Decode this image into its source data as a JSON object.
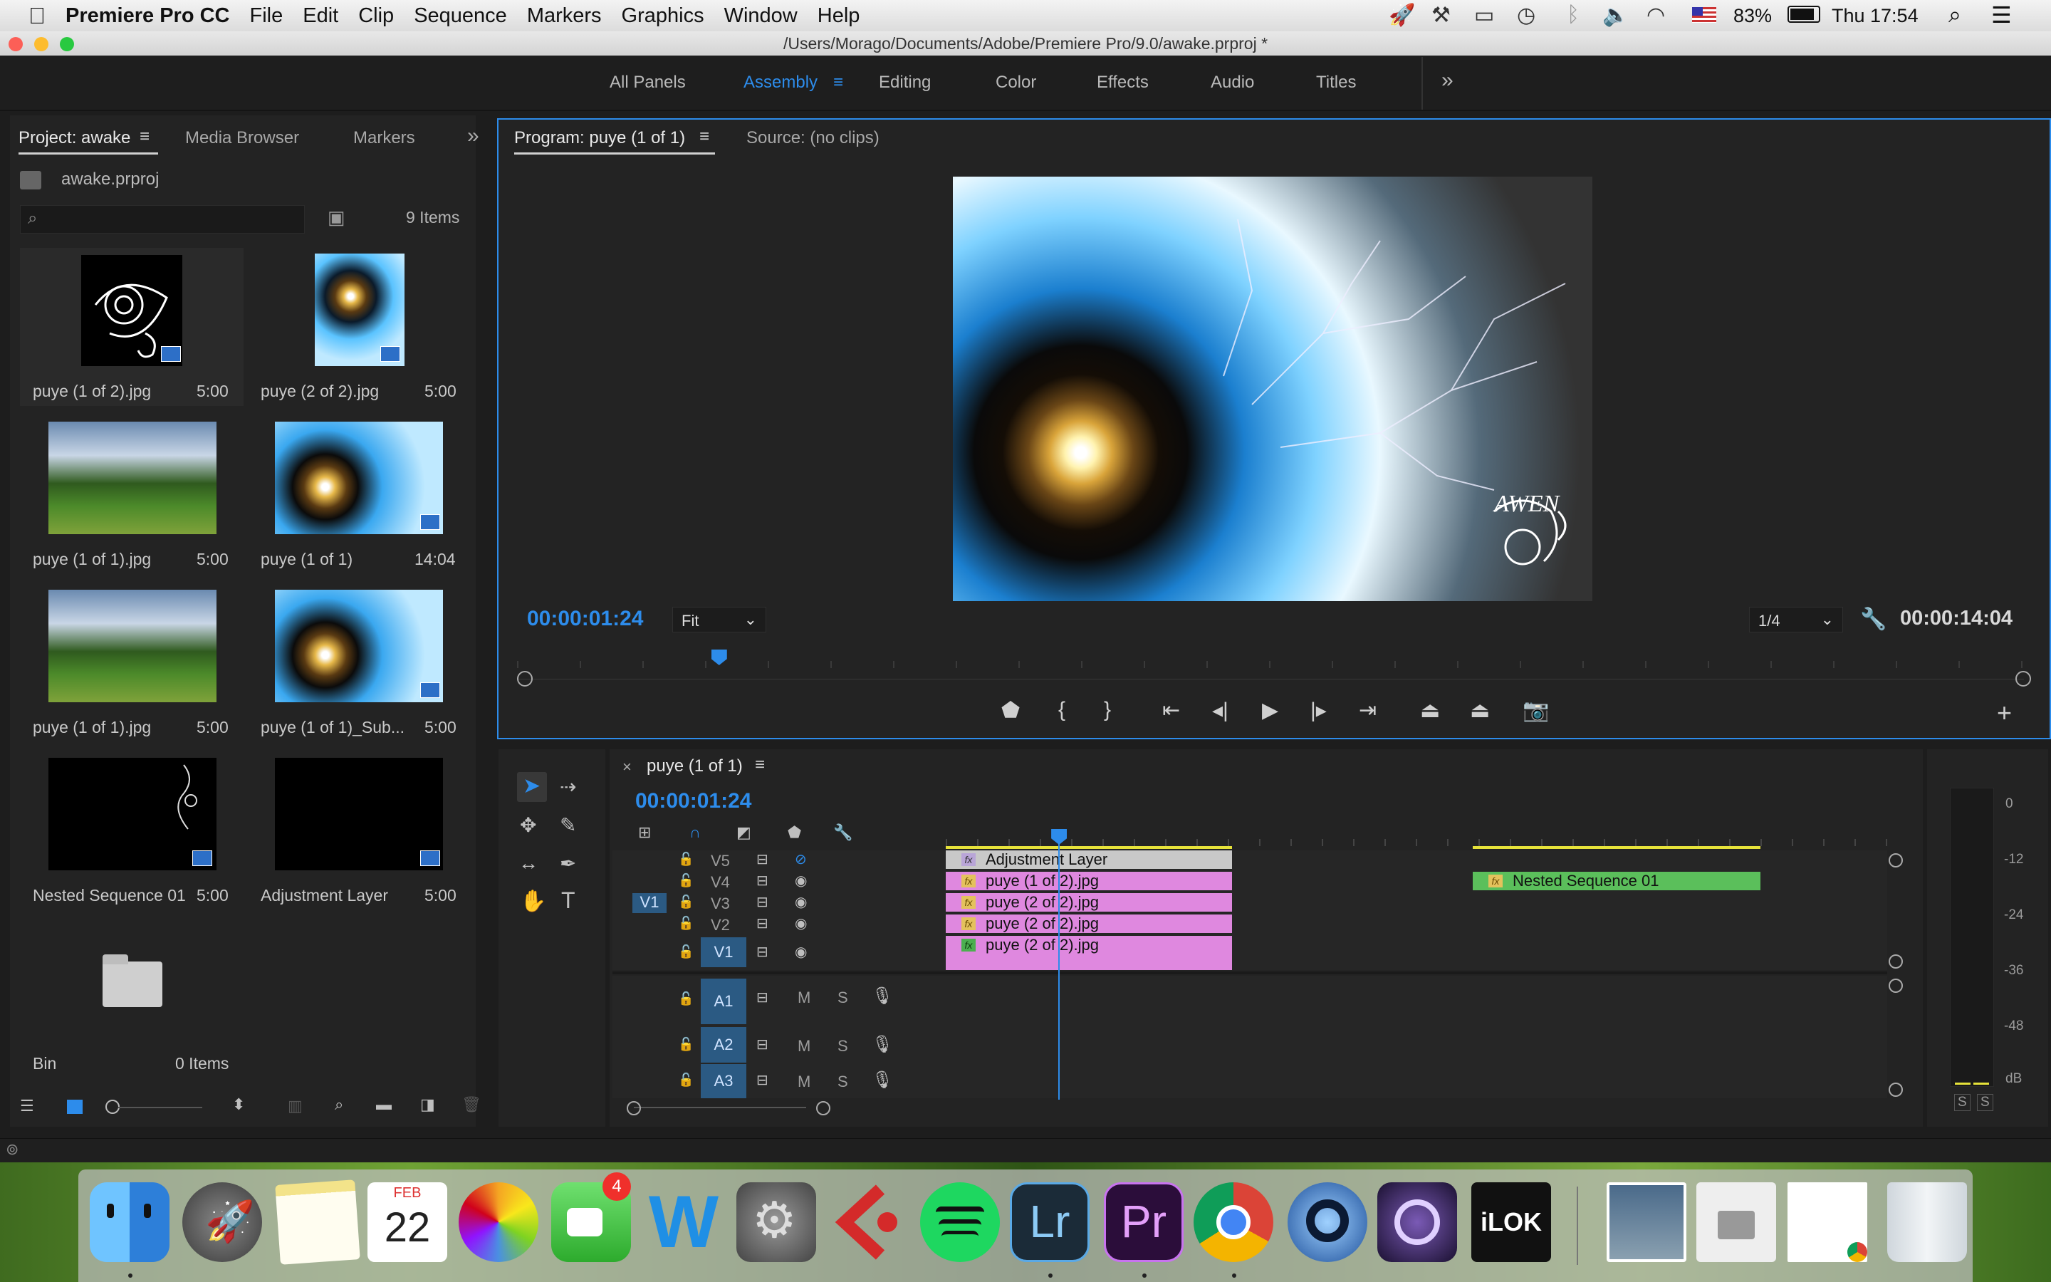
{
  "menubar": {
    "apple": "",
    "app_name": "Premiere Pro CC",
    "items": [
      "File",
      "Edit",
      "Clip",
      "Sequence",
      "Markers",
      "Graphics",
      "Window",
      "Help"
    ],
    "battery": "83%",
    "clock": "Thu 17:54"
  },
  "window": {
    "title": "/Users/Morago/Documents/Adobe/Premiere Pro/9.0/awake.prproj *"
  },
  "workspaces": {
    "tabs": [
      "All Panels",
      "Assembly",
      "Editing",
      "Color",
      "Effects",
      "Audio",
      "Titles"
    ],
    "active": "Assembly",
    "more": "»"
  },
  "project": {
    "tabs": [
      "Project: awake",
      "Media Browser",
      "Markers"
    ],
    "more": "»",
    "file": "awake.prproj",
    "items_count": "9 Items",
    "search_placeholder": "",
    "items": [
      {
        "name": "puye (1 of 2).jpg",
        "duration": "5:00"
      },
      {
        "name": "puye (2 of 2).jpg",
        "duration": "5:00"
      },
      {
        "name": "puye (1 of 1).jpg",
        "duration": "5:00"
      },
      {
        "name": "puye (1 of 1)",
        "duration": "14:04"
      },
      {
        "name": "puye (1 of 1).jpg",
        "duration": "5:00"
      },
      {
        "name": "puye (1 of 1)_Sub...",
        "duration": "5:00"
      },
      {
        "name": "Nested Sequence 01",
        "duration": "5:00"
      },
      {
        "name": "Adjustment Layer",
        "duration": "5:00"
      },
      {
        "name": "Bin",
        "duration": "0 Items"
      }
    ]
  },
  "program": {
    "tabs": [
      "Program: puye (1 of 1)",
      "Source: (no clips)"
    ],
    "timecode": "00:00:01:24",
    "fit": "Fit",
    "resolution": "1/4",
    "duration": "00:00:14:04",
    "playhead_fraction": 0.13,
    "watermark": "AWEN"
  },
  "timeline": {
    "tab": "puye (1 of 1)",
    "timecode": "00:00:01:24",
    "playhead_fraction": 0.12,
    "video_tracks": [
      "V5",
      "V4",
      "V3",
      "V2",
      "V1"
    ],
    "audio_tracks": [
      "A1",
      "A2",
      "A3"
    ],
    "source_patch": "V1",
    "track_buttons": {
      "mute": "M",
      "solo": "S"
    },
    "clips": [
      {
        "track": "V5",
        "name": "Adjustment Layer",
        "color": "#c8c8c8"
      },
      {
        "track": "V4",
        "name": "puye (1 of 2).jpg",
        "color": "#df88df"
      },
      {
        "track": "V3",
        "name": "puye (2 of 2).jpg",
        "color": "#df88df"
      },
      {
        "track": "V2",
        "name": "puye (2 of 2).jpg",
        "color": "#df88df"
      },
      {
        "track": "V1",
        "name": "puye (2 of 2).jpg",
        "color": "#df88df"
      },
      {
        "track": "V4",
        "name": "Nested Sequence 01",
        "color": "#5bbf5b"
      }
    ]
  },
  "meter": {
    "scale": [
      "0",
      "-12",
      "-24",
      "-36",
      "-48",
      "dB"
    ],
    "solo": [
      "S",
      "S"
    ]
  },
  "dock": {
    "calendar_month": "FEB",
    "calendar_day": "22",
    "facetime_badge": "4",
    "apps": [
      "finder",
      "launchpad",
      "notes",
      "calendar",
      "photos",
      "facetime",
      "word",
      "system-preferences",
      "cubase",
      "spotify",
      "lightroom",
      "premiere",
      "chrome",
      "quicktime",
      "pro-tools",
      "ilok",
      "photo-stack",
      "drive",
      "document",
      "trash"
    ],
    "lr_label": "Lr",
    "pr_label": "Pr",
    "ilok_label": "iLOK"
  },
  "colors": {
    "accent": "#2d8ceb",
    "panel_bg": "#232323",
    "clip_pink": "#df88df",
    "clip_green": "#5bbf5b"
  }
}
